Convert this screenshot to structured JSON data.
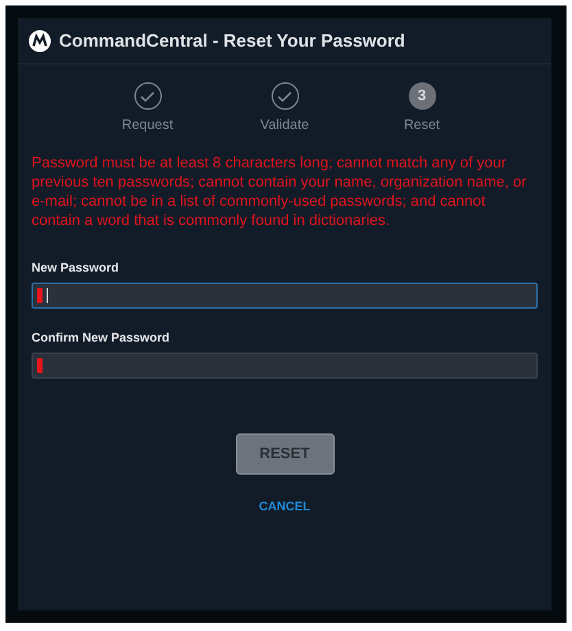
{
  "window": {
    "title": "CommandCentral - Reset Your Password"
  },
  "steps": [
    {
      "label": "Request",
      "kind": "done"
    },
    {
      "label": "Validate",
      "kind": "done"
    },
    {
      "label": "Reset",
      "kind": "current",
      "number": "3"
    }
  ],
  "message": "Password must be at least 8 characters long; cannot match any of your previous ten passwords; cannot contain your name, organization name, or e-mail; cannot be in a list of commonly-used passwords; and cannot contain a word that is commonly found in dictionaries.",
  "fields": [
    {
      "label": "New Password",
      "required": true,
      "focused": true
    },
    {
      "label": "Confirm New Password",
      "required": true,
      "focused": false
    }
  ],
  "reset_button": {
    "label": "RESET",
    "disabled": true
  },
  "cancel_link": {
    "label": "CANCEL"
  }
}
